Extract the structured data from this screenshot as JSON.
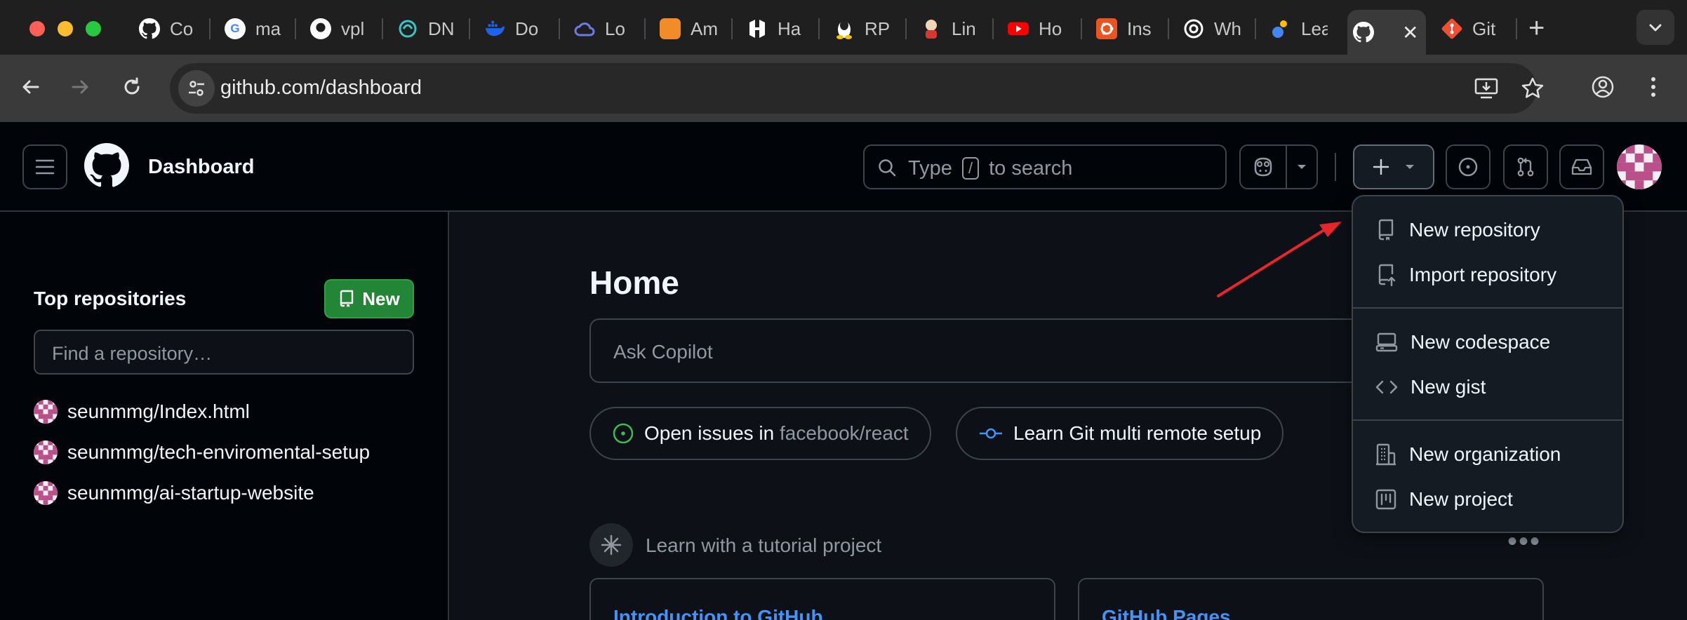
{
  "browser": {
    "tabs": [
      {
        "label": "Co",
        "icon": "github-icon",
        "color": "#ffffff"
      },
      {
        "label": "ma",
        "icon": "google-icon",
        "color": "#ffffff"
      },
      {
        "label": "vpl",
        "icon": "github-icon",
        "color": "#ffffff"
      },
      {
        "label": "DN",
        "icon": "dns-icon",
        "color": "#3bc4c4"
      },
      {
        "label": "Do",
        "icon": "docker-icon",
        "color": "#1d63ed"
      },
      {
        "label": "Lo",
        "icon": "cloud-icon",
        "color": "#6c7ae0"
      },
      {
        "label": "Am",
        "icon": "package-icon",
        "color": "#f28c28"
      },
      {
        "label": "Ha",
        "icon": "hashicorp-icon",
        "color": "#ffffff"
      },
      {
        "label": "RP",
        "icon": "linux-icon",
        "color": "#f5c400"
      },
      {
        "label": "Lin",
        "icon": "jenkins-icon",
        "color": "#d33833"
      },
      {
        "label": "Ho",
        "icon": "youtube-icon",
        "color": "#ff0000"
      },
      {
        "label": "Ins",
        "icon": "ubuntu-icon",
        "color": "#e95420"
      },
      {
        "label": "Wh",
        "icon": "openai-icon",
        "color": "#ffffff"
      },
      {
        "label": "Lea",
        "icon": "learn-icon",
        "color": "#4285f4"
      }
    ],
    "active_tab": {
      "icon": "github-icon",
      "close": "✕"
    },
    "last_tab": {
      "label": "Git",
      "icon": "git-icon",
      "color": "#f05032"
    },
    "new_tab": "+",
    "url": "github.com/dashboard"
  },
  "header": {
    "title": "Dashboard",
    "search": {
      "pre": "Type",
      "key": "/",
      "post": "to search"
    }
  },
  "sidebar": {
    "title": "Top repositories",
    "new_label": "New",
    "find_placeholder": "Find a repository…",
    "repos": [
      {
        "name": "seunmmg/Index.html"
      },
      {
        "name": "seunmmg/tech-enviromental-setup"
      },
      {
        "name": "seunmmg/ai-startup-website"
      }
    ]
  },
  "main": {
    "title": "Home",
    "copilot_placeholder": "Ask Copilot",
    "chips": [
      {
        "text": "Open issues in",
        "muted": "facebook/react"
      },
      {
        "text": "Learn Git multi remote setup"
      }
    ],
    "tutorial_label": "Learn with a tutorial project",
    "cards": [
      {
        "title": "Introduction to GitHub"
      },
      {
        "title": "GitHub Pages"
      }
    ]
  },
  "menu": {
    "items": [
      {
        "label": "New repository",
        "icon": "repo-icon"
      },
      {
        "label": "Import repository",
        "icon": "repo-push-icon"
      },
      {
        "label": "New codespace",
        "icon": "codespace-icon"
      },
      {
        "label": "New gist",
        "icon": "code-icon"
      },
      {
        "label": "New organization",
        "icon": "organization-icon"
      },
      {
        "label": "New project",
        "icon": "project-icon"
      }
    ]
  },
  "colors": {
    "accent_green": "#238636",
    "link_blue": "#4493f8",
    "annotation_arrow": "#e5262d"
  }
}
